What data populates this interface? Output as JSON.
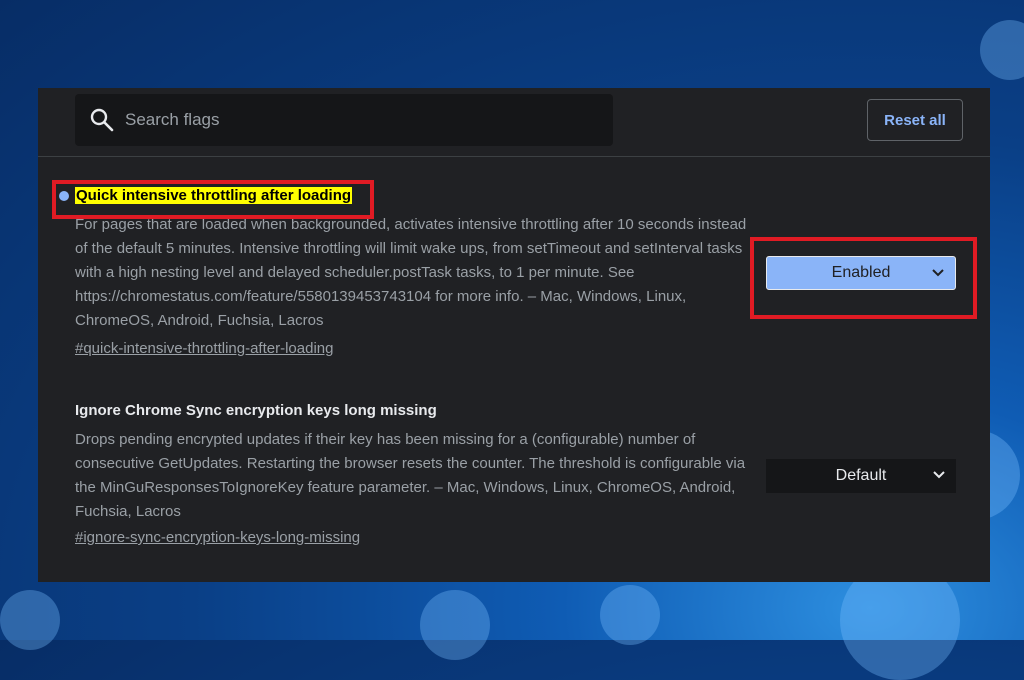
{
  "search": {
    "placeholder": "Search flags",
    "value": ""
  },
  "reset_all_label": "Reset all",
  "flags": [
    {
      "title": "Quick intensive throttling after loading",
      "description": "For pages that are loaded when backgrounded, activates intensive throttling after 10 seconds instead of the default 5 minutes. Intensive throttling will limit wake ups, from setTimeout and setInterval tasks with a high nesting level and delayed scheduler.postTask tasks, to 1 per minute. See https://chromestatus.com/feature/5580139453743104 for more info. – Mac, Windows, Linux, ChromeOS, Android, Fuchsia, Lacros",
      "link": "#quick-intensive-throttling-after-loading",
      "selected": "Enabled",
      "modified": true,
      "highlight_color": "#ffff00"
    },
    {
      "title": "Ignore Chrome Sync encryption keys long missing",
      "description": "Drops pending encrypted updates if their key has been missing for a (configurable) number of consecutive GetUpdates. Restarting the browser resets the counter. The threshold is configurable via the MinGuResponsesToIgnoreKey feature parameter. – Mac, Windows, Linux, ChromeOS, Android, Fuchsia, Lacros",
      "link": "#ignore-sync-encryption-keys-long-missing",
      "selected": "Default",
      "modified": false
    }
  ],
  "colors": {
    "background": "#202124",
    "accent": "#8ab4f8",
    "annotation_red": "#e01b24"
  },
  "icons": {
    "search": "search-icon",
    "dropdown": "chevron-down-icon",
    "modified_marker": "modified-dot-icon"
  }
}
